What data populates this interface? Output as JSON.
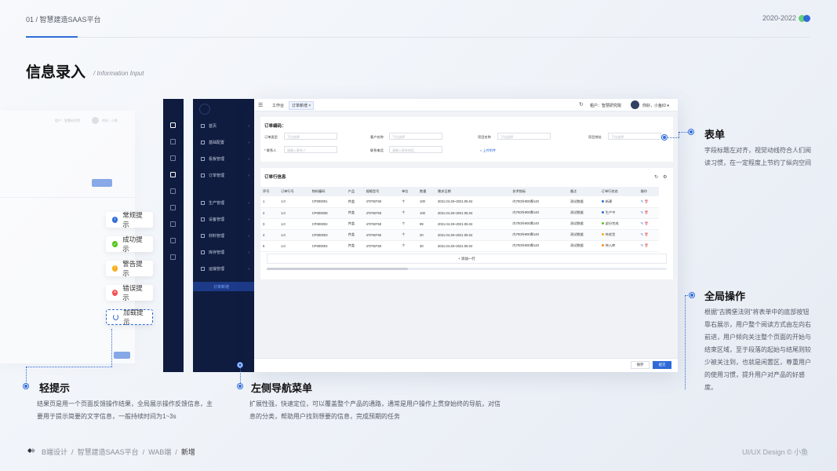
{
  "header": {
    "left": "01 / 智慧建造SAAS平台",
    "right": "2020-2022",
    "colors": {
      "accent": "#2f6bd8",
      "green": "#6ad07a",
      "nav_bg": "#0f1c3f"
    }
  },
  "title": {
    "main": "信息录入",
    "sub": "/ Information Input"
  },
  "ghost": {
    "tenant": "租户：智慧研究院",
    "hello": "你好，小鱼"
  },
  "tips": [
    {
      "label": "常规提示",
      "icon": "info-icon",
      "color": "#2f6bd8"
    },
    {
      "label": "成功提示",
      "icon": "check-icon",
      "color": "#52c41a"
    },
    {
      "label": "警告提示",
      "icon": "warning-icon",
      "color": "#faad14"
    },
    {
      "label": "错误提示",
      "icon": "error-icon",
      "color": "#f5504f"
    },
    {
      "label": "加载提示",
      "icon": "loading-icon",
      "color": "#2f6bd8"
    }
  ],
  "nav": {
    "items": [
      "首页",
      "基础配置",
      "看板管理",
      "订单管理",
      "生产管理",
      "设备管理",
      "材料管理",
      "库存管理",
      "运输管理"
    ],
    "active_sub": "订单新增"
  },
  "topbar": {
    "tabs": [
      "工作台",
      "订单新增 ×"
    ],
    "tenant": "租户：智慧研究院",
    "hello": "你好，小鱼ID ▾"
  },
  "form": {
    "title": "订单编码：",
    "fields": [
      {
        "label": "订单类型",
        "placeholder": "下拉选择"
      },
      {
        "label": "客户名称",
        "placeholder": "下拉选择"
      },
      {
        "label": "项目名称",
        "placeholder": "下拉选择"
      },
      {
        "label": "项目地址",
        "placeholder": "下拉选择"
      },
      {
        "label": "* 联系人",
        "placeholder": "请输入联系人"
      },
      {
        "label": "联系电话",
        "placeholder": "请输入联系电话"
      }
    ],
    "upload": "上传附件"
  },
  "table": {
    "title": "订单行信息",
    "headers": [
      "序号",
      "订单行号",
      "物料编码",
      "产品",
      "规格型号",
      "单位",
      "数量",
      "需求日期",
      "技术指标",
      "备注",
      "订单行状态",
      "操作"
    ],
    "rows": [
      {
        "no": "1",
        "line": "1.0",
        "code": "CP000001",
        "product": "井盖",
        "spec": "470*60*50",
        "unit": "个",
        "qty": "100",
        "date": "2021.04.28~2021.05.04",
        "tech": "内700外900厚140",
        "note": "测试数据",
        "status": "新建",
        "status_color": "#2f6bd8"
      },
      {
        "no": "2",
        "line": "1.0",
        "code": "CP000008",
        "product": "井盖",
        "spec": "470*60*50",
        "unit": "个",
        "qty": "100",
        "date": "2021.04.28~2021.05.04",
        "tech": "内700外900厚140",
        "note": "测试数据",
        "status": "生产中",
        "status_color": "#2f6bd8"
      },
      {
        "no": "3",
        "line": "1.0",
        "code": "CP000002",
        "product": "井盖",
        "spec": "470*60*50",
        "unit": "个",
        "qty": "99",
        "date": "2021.04.28~2021.05.04",
        "tech": "内700外900厚140",
        "note": "测试数据",
        "status": "部分完成",
        "status_color": "#52c41a"
      },
      {
        "no": "4",
        "line": "1.0",
        "code": "CP000003",
        "product": "井盖",
        "spec": "470*60*50",
        "unit": "个",
        "qty": "20",
        "date": "2021.04.28~2021.05.04",
        "tech": "内700外900厚140",
        "note": "测试数据",
        "status": "待发货",
        "status_color": "#faad14"
      },
      {
        "no": "5",
        "line": "1.0",
        "code": "CP000004",
        "product": "井盖",
        "spec": "470*60*50",
        "unit": "个",
        "qty": "30",
        "date": "2021.04.28~2021.05.04",
        "tech": "内700外900厚140",
        "note": "测试数据",
        "status": "待入库",
        "status_color": "#fa8c16"
      }
    ],
    "add_row": "+ 添加一行"
  },
  "footer": {
    "save": "保存",
    "submit": "提交"
  },
  "annotations": {
    "form": {
      "title": "表单",
      "body": "字段标题左对齐，视觉动线符合人们阅读习惯，在一定程度上节约了纵向空间"
    },
    "global": {
      "title": "全局操作",
      "body": "根据“古腾堡法则”将表单中的底部按钮靠右展示，用户整个阅读方式由左向右前进，用户倾向关注整个页面的开始与结束区域，至于段落的起始与结尾则较少被关注到，也就是闲置区，尊重用户的使用习惯，提升用户对产品的好感度。"
    },
    "tips": {
      "title": "轻提示",
      "body": "结果页是用一个页面反馈操作结果，全局展示操作反馈信息，主要用于提示简要的文字信息，一般持续时间为1~3s"
    },
    "nav": {
      "title": "左侧导航菜单",
      "body": "扩展性强，快速定位，可以覆盖整个产品的通路，通常是用户操作上贯穿始终的导航，对信息的分类，帮助用户找到想要的信息，完成预期的任务"
    }
  },
  "bottom": {
    "crumb1": "B端设计",
    "crumb2": "智慧建造SAAS平台",
    "crumb3": "WAB端",
    "crumb4": "新增",
    "sep": "/",
    "right": "UI/UX Design © 小鱼"
  }
}
